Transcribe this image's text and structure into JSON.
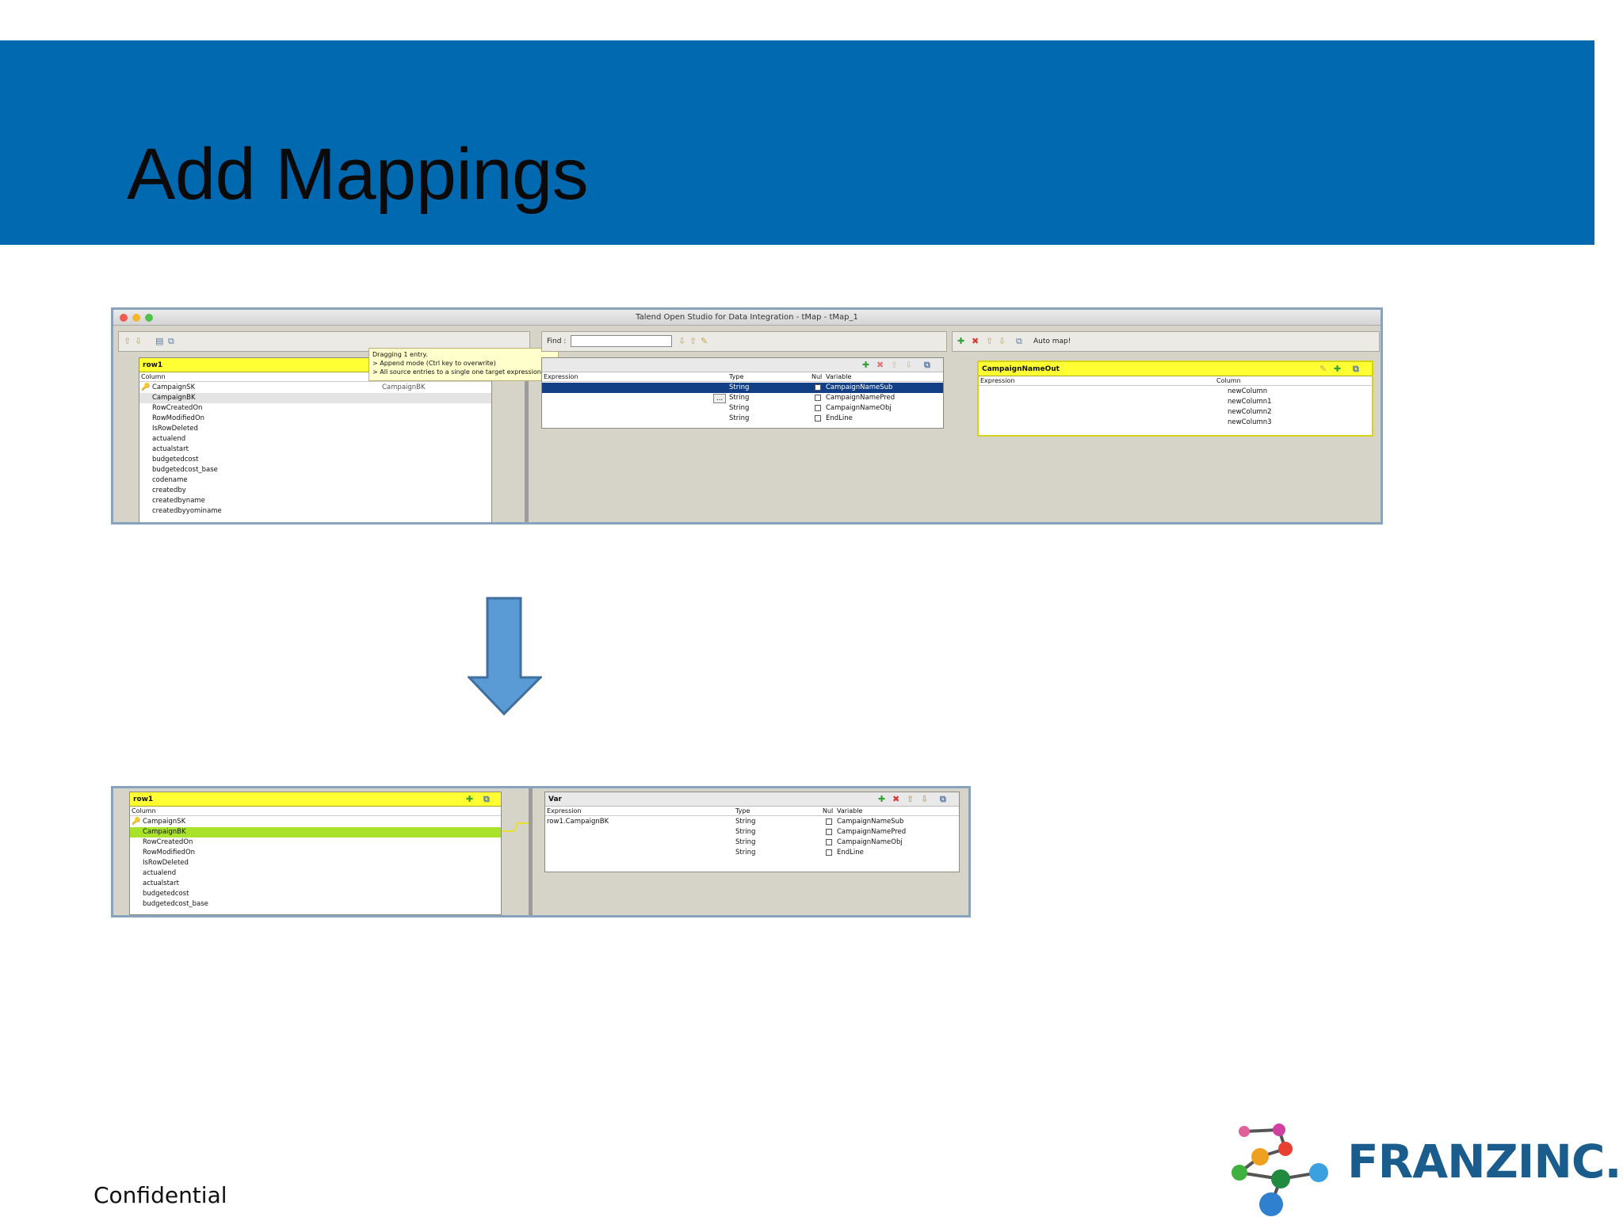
{
  "slide": {
    "title": "Add Mappings",
    "footer": "Confidential",
    "logo_text": "FRANZINC."
  },
  "colors": {
    "banner": "#0069b0",
    "panel_header": "#ffff33",
    "selected_row": "#a8e22a",
    "selected_var_row": "#123f85"
  },
  "shot1": {
    "window_title": "Talend Open Studio for Data Integration - tMap - tMap_1",
    "find_label": "Find :",
    "auto_map_label": "Auto map!",
    "tooltip": {
      "line1": "Dragging 1 entry.",
      "line2": " > Append mode (Ctrl key to overwrite)",
      "line3": "> All source entries to a single one target expression"
    },
    "input": {
      "name": "row1",
      "column_header": "Column",
      "drag_preview": "CampaignBK",
      "columns": [
        "CampaignSK",
        "CampaignBK",
        "RowCreatedOn",
        "RowModifiedOn",
        "IsRowDeleted",
        "actualend",
        "actualstart",
        "budgetedcost",
        "budgetedcost_base",
        "codename",
        "createdby",
        "createdbyname",
        "createdbyyominame"
      ]
    },
    "vars": {
      "headers": {
        "expression": "Expression",
        "type": "Type",
        "nullable": "Nul",
        "variable": "Variable"
      },
      "button": "...",
      "rows": [
        {
          "expression": "",
          "type": "String",
          "variable": "CampaignNameSub"
        },
        {
          "expression": "",
          "type": "String",
          "variable": "CampaignNamePred"
        },
        {
          "expression": "",
          "type": "String",
          "variable": "CampaignNameObj"
        },
        {
          "expression": "",
          "type": "String",
          "variable": "EndLine"
        }
      ]
    },
    "output": {
      "name": "CampaignNameOut",
      "headers": {
        "expression": "Expression",
        "column": "Column"
      },
      "columns": [
        "newColumn",
        "newColumn1",
        "newColumn2",
        "newColumn3"
      ]
    }
  },
  "shot2": {
    "input": {
      "name": "row1",
      "column_header": "Column",
      "columns": [
        "CampaignSK",
        "CampaignBK",
        "RowCreatedOn",
        "RowModifiedOn",
        "IsRowDeleted",
        "actualend",
        "actualstart",
        "budgetedcost",
        "budgetedcost_base"
      ]
    },
    "vars": {
      "name": "Var",
      "headers": {
        "expression": "Expression",
        "type": "Type",
        "nullable": "Nul",
        "variable": "Variable"
      },
      "rows": [
        {
          "expression": "row1.CampaignBK",
          "type": "String",
          "variable": "CampaignNameSub"
        },
        {
          "expression": "",
          "type": "String",
          "variable": "CampaignNamePred"
        },
        {
          "expression": "",
          "type": "String",
          "variable": "CampaignNameObj"
        },
        {
          "expression": "",
          "type": "String",
          "variable": "EndLine"
        }
      ]
    }
  }
}
